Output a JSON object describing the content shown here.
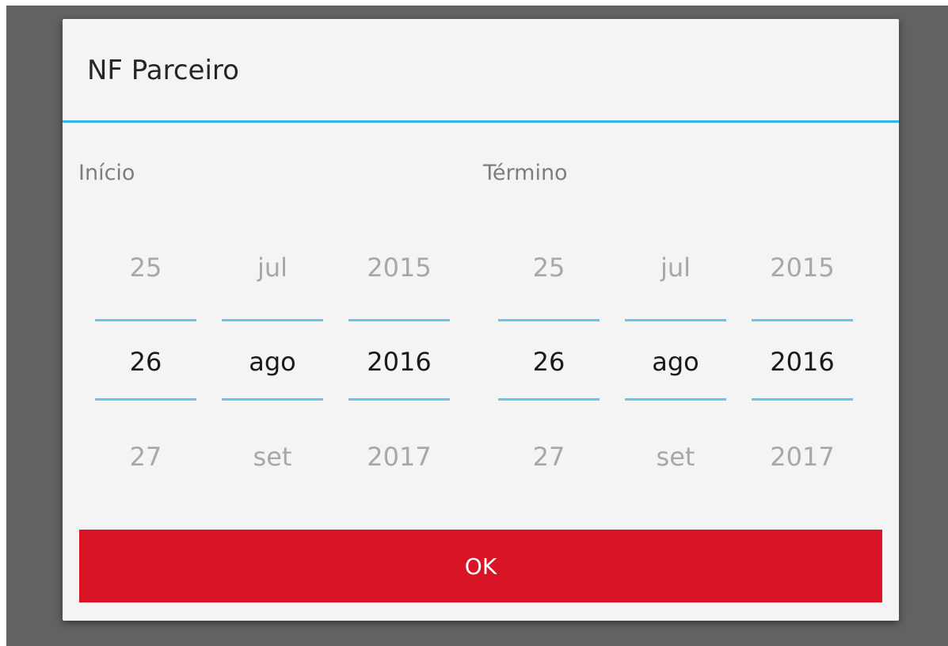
{
  "dialog": {
    "title": "NF Parceiro",
    "ok_label": "OK"
  },
  "colors": {
    "accent": "#33b5e5",
    "button": "#d91427",
    "backdrop": "#626262"
  },
  "start": {
    "label": "Início",
    "day": {
      "prev": "25",
      "current": "26",
      "next": "27"
    },
    "month": {
      "prev": "jul",
      "current": "ago",
      "next": "set"
    },
    "year": {
      "prev": "2015",
      "current": "2016",
      "next": "2017"
    }
  },
  "end": {
    "label": "Término",
    "day": {
      "prev": "25",
      "current": "26",
      "next": "27"
    },
    "month": {
      "prev": "jul",
      "current": "ago",
      "next": "set"
    },
    "year": {
      "prev": "2015",
      "current": "2016",
      "next": "2017"
    }
  }
}
